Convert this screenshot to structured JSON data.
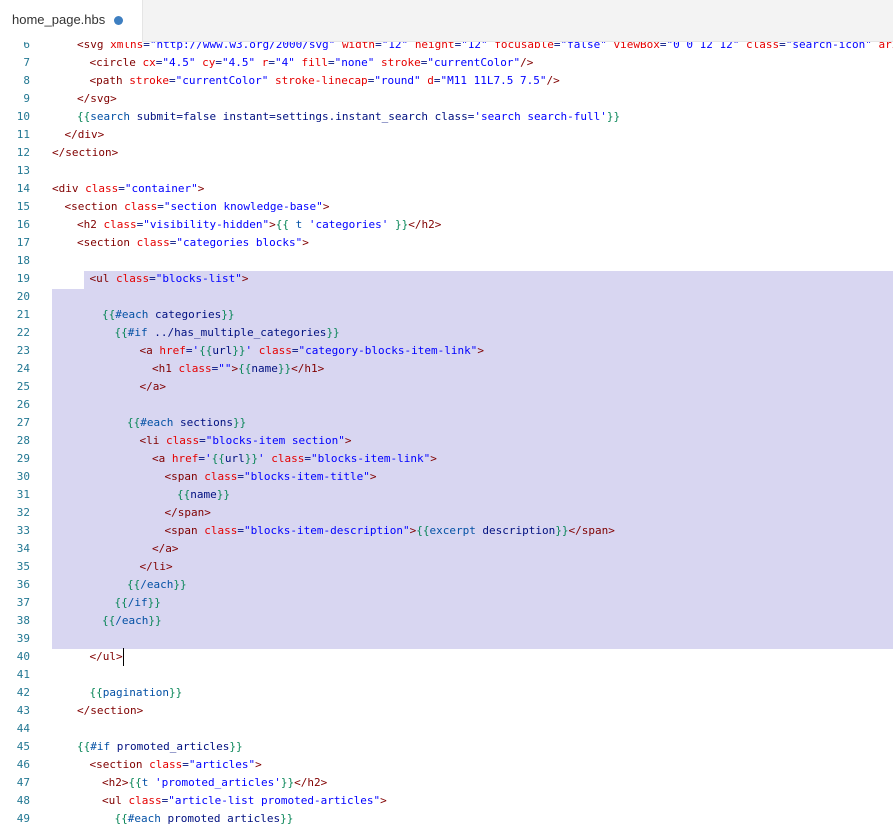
{
  "tab": {
    "filename": "home_page.hbs",
    "modified": true
  },
  "editor": {
    "lines": [
      {
        "n": "6",
        "indent": 2,
        "seg": [
          [
            "tg",
            "<svg "
          ],
          [
            "at",
            "xmlns"
          ],
          [
            "pl",
            "="
          ],
          [
            "st",
            "\"http://www.w3.org/2000/svg\""
          ],
          [
            "pl",
            " "
          ],
          [
            "at",
            "width"
          ],
          [
            "pl",
            "="
          ],
          [
            "st",
            "\"12\""
          ],
          [
            "pl",
            " "
          ],
          [
            "at",
            "height"
          ],
          [
            "pl",
            "="
          ],
          [
            "st",
            "\"12\""
          ],
          [
            "pl",
            " "
          ],
          [
            "at",
            "focusable"
          ],
          [
            "pl",
            "="
          ],
          [
            "st",
            "\"false\""
          ],
          [
            "pl",
            " "
          ],
          [
            "at",
            "viewBox"
          ],
          [
            "pl",
            "="
          ],
          [
            "st",
            "\"0 0 12 12\""
          ],
          [
            "pl",
            " "
          ],
          [
            "at",
            "class"
          ],
          [
            "pl",
            "="
          ],
          [
            "st",
            "\"search-icon\""
          ],
          [
            "pl",
            " "
          ],
          [
            "at",
            "aria-"
          ]
        ]
      },
      {
        "n": "7",
        "indent": 3,
        "seg": [
          [
            "tg",
            "<circle "
          ],
          [
            "at",
            "cx"
          ],
          [
            "pl",
            "="
          ],
          [
            "st",
            "\"4.5\""
          ],
          [
            "pl",
            " "
          ],
          [
            "at",
            "cy"
          ],
          [
            "pl",
            "="
          ],
          [
            "st",
            "\"4.5\""
          ],
          [
            "pl",
            " "
          ],
          [
            "at",
            "r"
          ],
          [
            "pl",
            "="
          ],
          [
            "st",
            "\"4\""
          ],
          [
            "pl",
            " "
          ],
          [
            "at",
            "fill"
          ],
          [
            "pl",
            "="
          ],
          [
            "st",
            "\"none\""
          ],
          [
            "pl",
            " "
          ],
          [
            "at",
            "stroke"
          ],
          [
            "pl",
            "="
          ],
          [
            "st",
            "\"currentColor\""
          ],
          [
            "tg",
            "/>"
          ]
        ]
      },
      {
        "n": "8",
        "indent": 3,
        "seg": [
          [
            "tg",
            "<path "
          ],
          [
            "at",
            "stroke"
          ],
          [
            "pl",
            "="
          ],
          [
            "st",
            "\"currentColor\""
          ],
          [
            "pl",
            " "
          ],
          [
            "at",
            "stroke-linecap"
          ],
          [
            "pl",
            "="
          ],
          [
            "st",
            "\"round\""
          ],
          [
            "pl",
            " "
          ],
          [
            "at",
            "d"
          ],
          [
            "pl",
            "="
          ],
          [
            "st",
            "\"M11 11L7.5 7.5\""
          ],
          [
            "tg",
            "/>"
          ]
        ]
      },
      {
        "n": "9",
        "indent": 2,
        "seg": [
          [
            "tg",
            "</svg>"
          ]
        ]
      },
      {
        "n": "10",
        "indent": 2,
        "seg": [
          [
            "hb",
            "{{"
          ],
          [
            "hk",
            "search"
          ],
          [
            "pl",
            " submit=false instant=settings.instant_search class="
          ],
          [
            "st",
            "'search search-full'"
          ],
          [
            "hb",
            "}}"
          ]
        ]
      },
      {
        "n": "11",
        "indent": 1,
        "seg": [
          [
            "tg",
            "</div>"
          ]
        ]
      },
      {
        "n": "12",
        "indent": 0,
        "seg": [
          [
            "tg",
            "</section>"
          ]
        ]
      },
      {
        "n": "13",
        "indent": 0,
        "seg": []
      },
      {
        "n": "14",
        "indent": 0,
        "seg": [
          [
            "tg",
            "<div "
          ],
          [
            "at",
            "class"
          ],
          [
            "pl",
            "="
          ],
          [
            "st",
            "\"container\""
          ],
          [
            "tg",
            ">"
          ]
        ]
      },
      {
        "n": "15",
        "indent": 1,
        "seg": [
          [
            "tg",
            "<section "
          ],
          [
            "at",
            "class"
          ],
          [
            "pl",
            "="
          ],
          [
            "st",
            "\"section knowledge-base\""
          ],
          [
            "tg",
            ">"
          ]
        ]
      },
      {
        "n": "16",
        "indent": 2,
        "seg": [
          [
            "tg",
            "<h2 "
          ],
          [
            "at",
            "class"
          ],
          [
            "pl",
            "="
          ],
          [
            "st",
            "\"visibility-hidden\""
          ],
          [
            "tg",
            ">"
          ],
          [
            "hb",
            "{{ "
          ],
          [
            "hk",
            "t"
          ],
          [
            "pl",
            " "
          ],
          [
            "st",
            "'categories'"
          ],
          [
            "hb",
            " }}"
          ],
          [
            "tg",
            "</h2>"
          ]
        ]
      },
      {
        "n": "17",
        "indent": 2,
        "seg": [
          [
            "tg",
            "<section "
          ],
          [
            "at",
            "class"
          ],
          [
            "pl",
            "="
          ],
          [
            "st",
            "\"categories blocks\""
          ],
          [
            "tg",
            ">"
          ]
        ]
      },
      {
        "n": "18",
        "indent": 0,
        "seg": []
      },
      {
        "n": "19",
        "indent": 3,
        "seg": [
          [
            "tg",
            "<ul "
          ],
          [
            "at",
            "class"
          ],
          [
            "pl",
            "="
          ],
          [
            "st",
            "\"blocks-list\""
          ],
          [
            "tg",
            ">"
          ]
        ]
      },
      {
        "n": "20",
        "indent": 0,
        "seg": []
      },
      {
        "n": "21",
        "indent": 4,
        "seg": [
          [
            "hb",
            "{{"
          ],
          [
            "hk",
            "#each"
          ],
          [
            "pl",
            " categories"
          ],
          [
            "hb",
            "}}"
          ]
        ]
      },
      {
        "n": "22",
        "indent": 5,
        "seg": [
          [
            "hb",
            "{{"
          ],
          [
            "hk",
            "#if"
          ],
          [
            "pl",
            " ../has_multiple_categories"
          ],
          [
            "hb",
            "}}"
          ]
        ]
      },
      {
        "n": "23",
        "indent": 7,
        "seg": [
          [
            "tg",
            "<a "
          ],
          [
            "at",
            "href"
          ],
          [
            "pl",
            "="
          ],
          [
            "st",
            "'"
          ],
          [
            "hb",
            "{{"
          ],
          [
            "pl",
            "url"
          ],
          [
            "hb",
            "}}"
          ],
          [
            "st",
            "'"
          ],
          [
            "pl",
            " "
          ],
          [
            "at",
            "class"
          ],
          [
            "pl",
            "="
          ],
          [
            "st",
            "\"category-blocks-item-link\""
          ],
          [
            "tg",
            ">"
          ]
        ]
      },
      {
        "n": "24",
        "indent": 8,
        "seg": [
          [
            "tg",
            "<h1 "
          ],
          [
            "at",
            "class"
          ],
          [
            "pl",
            "="
          ],
          [
            "st",
            "\"\""
          ],
          [
            "tg",
            ">"
          ],
          [
            "hb",
            "{{"
          ],
          [
            "pl",
            "name"
          ],
          [
            "hb",
            "}}"
          ],
          [
            "tg",
            "</h1>"
          ]
        ]
      },
      {
        "n": "25",
        "indent": 7,
        "seg": [
          [
            "tg",
            "</a>"
          ]
        ]
      },
      {
        "n": "26",
        "indent": 0,
        "seg": []
      },
      {
        "n": "27",
        "indent": 6,
        "seg": [
          [
            "hb",
            "{{"
          ],
          [
            "hk",
            "#each"
          ],
          [
            "pl",
            " sections"
          ],
          [
            "hb",
            "}}"
          ]
        ]
      },
      {
        "n": "28",
        "indent": 7,
        "seg": [
          [
            "tg",
            "<li "
          ],
          [
            "at",
            "class"
          ],
          [
            "pl",
            "="
          ],
          [
            "st",
            "\"blocks-item section\""
          ],
          [
            "tg",
            ">"
          ]
        ]
      },
      {
        "n": "29",
        "indent": 8,
        "seg": [
          [
            "tg",
            "<a "
          ],
          [
            "at",
            "href"
          ],
          [
            "pl",
            "="
          ],
          [
            "st",
            "'"
          ],
          [
            "hb",
            "{{"
          ],
          [
            "pl",
            "url"
          ],
          [
            "hb",
            "}}"
          ],
          [
            "st",
            "'"
          ],
          [
            "pl",
            " "
          ],
          [
            "at",
            "class"
          ],
          [
            "pl",
            "="
          ],
          [
            "st",
            "\"blocks-item-link\""
          ],
          [
            "tg",
            ">"
          ]
        ]
      },
      {
        "n": "30",
        "indent": 9,
        "seg": [
          [
            "tg",
            "<span "
          ],
          [
            "at",
            "class"
          ],
          [
            "pl",
            "="
          ],
          [
            "st",
            "\"blocks-item-title\""
          ],
          [
            "tg",
            ">"
          ]
        ]
      },
      {
        "n": "31",
        "indent": 10,
        "seg": [
          [
            "hb",
            "{{"
          ],
          [
            "pl",
            "name"
          ],
          [
            "hb",
            "}}"
          ]
        ]
      },
      {
        "n": "32",
        "indent": 9,
        "seg": [
          [
            "tg",
            "</span>"
          ]
        ]
      },
      {
        "n": "33",
        "indent": 9,
        "seg": [
          [
            "tg",
            "<span "
          ],
          [
            "at",
            "class"
          ],
          [
            "pl",
            "="
          ],
          [
            "st",
            "\"blocks-item-description\""
          ],
          [
            "tg",
            ">"
          ],
          [
            "hb",
            "{{"
          ],
          [
            "hk",
            "excerpt"
          ],
          [
            "pl",
            " description"
          ],
          [
            "hb",
            "}}"
          ],
          [
            "tg",
            "</span>"
          ]
        ]
      },
      {
        "n": "34",
        "indent": 8,
        "seg": [
          [
            "tg",
            "</a>"
          ]
        ]
      },
      {
        "n": "35",
        "indent": 7,
        "seg": [
          [
            "tg",
            "</li>"
          ]
        ]
      },
      {
        "n": "36",
        "indent": 6,
        "seg": [
          [
            "hb",
            "{{"
          ],
          [
            "hk",
            "/each"
          ],
          [
            "hb",
            "}}"
          ]
        ]
      },
      {
        "n": "37",
        "indent": 5,
        "seg": [
          [
            "hb",
            "{{"
          ],
          [
            "hk",
            "/if"
          ],
          [
            "hb",
            "}}"
          ]
        ]
      },
      {
        "n": "38",
        "indent": 4,
        "seg": [
          [
            "hb",
            "{{"
          ],
          [
            "hk",
            "/each"
          ],
          [
            "hb",
            "}}"
          ]
        ]
      },
      {
        "n": "39",
        "indent": 0,
        "seg": []
      },
      {
        "n": "40",
        "indent": 3,
        "seg": [
          [
            "tg",
            "</ul>"
          ]
        ]
      },
      {
        "n": "41",
        "indent": 0,
        "seg": []
      },
      {
        "n": "42",
        "indent": 3,
        "seg": [
          [
            "hb",
            "{{"
          ],
          [
            "hk",
            "pagination"
          ],
          [
            "hb",
            "}}"
          ]
        ]
      },
      {
        "n": "43",
        "indent": 2,
        "seg": [
          [
            "tg",
            "</section>"
          ]
        ]
      },
      {
        "n": "44",
        "indent": 0,
        "seg": []
      },
      {
        "n": "45",
        "indent": 2,
        "seg": [
          [
            "hb",
            "{{"
          ],
          [
            "hk",
            "#if"
          ],
          [
            "pl",
            " promoted_articles"
          ],
          [
            "hb",
            "}}"
          ]
        ]
      },
      {
        "n": "46",
        "indent": 3,
        "seg": [
          [
            "tg",
            "<section "
          ],
          [
            "at",
            "class"
          ],
          [
            "pl",
            "="
          ],
          [
            "st",
            "\"articles\""
          ],
          [
            "tg",
            ">"
          ]
        ]
      },
      {
        "n": "47",
        "indent": 4,
        "seg": [
          [
            "tg",
            "<h2>"
          ],
          [
            "hb",
            "{{"
          ],
          [
            "hk",
            "t"
          ],
          [
            "pl",
            " "
          ],
          [
            "st",
            "'promoted_articles'"
          ],
          [
            "hb",
            "}}"
          ],
          [
            "tg",
            "</h2>"
          ]
        ]
      },
      {
        "n": "48",
        "indent": 4,
        "seg": [
          [
            "tg",
            "<ul "
          ],
          [
            "at",
            "class"
          ],
          [
            "pl",
            "="
          ],
          [
            "st",
            "\"article-list promoted-articles\""
          ],
          [
            "tg",
            ">"
          ]
        ]
      },
      {
        "n": "49",
        "indent": 5,
        "seg": [
          [
            "hb",
            "{{"
          ],
          [
            "hk",
            "#each"
          ],
          [
            "pl",
            " promoted_articles"
          ],
          [
            "hb",
            "}}"
          ]
        ]
      }
    ]
  }
}
